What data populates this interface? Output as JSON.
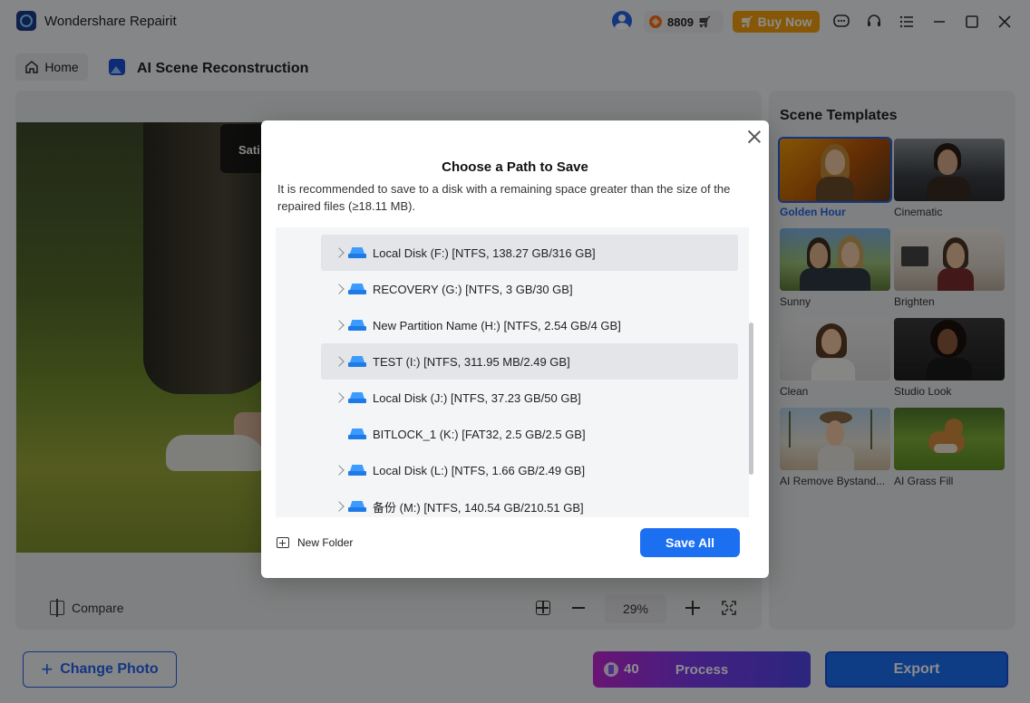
{
  "app": {
    "title": "Wondershare Repairit"
  },
  "header": {
    "credits": "8809",
    "buy_now": "Buy Now"
  },
  "nav": {
    "home": "Home",
    "page_title": "AI Scene Reconstruction"
  },
  "preview": {
    "badge_text": "Sati",
    "compare": "Compare",
    "zoom": "29%"
  },
  "templates": {
    "title": "Scene Templates",
    "items": [
      {
        "label": "Golden Hour",
        "selected": true
      },
      {
        "label": "Cinematic",
        "selected": false
      },
      {
        "label": "Sunny",
        "selected": false
      },
      {
        "label": "Brighten",
        "selected": false
      },
      {
        "label": "Clean",
        "selected": false
      },
      {
        "label": "Studio Look",
        "selected": false
      },
      {
        "label": "AI Remove Bystand...",
        "selected": false
      },
      {
        "label": "AI Grass Fill",
        "selected": false
      }
    ]
  },
  "bottom": {
    "change_photo": "Change Photo",
    "process_credits": "40",
    "process": "Process",
    "export": "Export"
  },
  "dialog": {
    "title": "Choose a Path to Save",
    "description": "It is recommended to save to a disk with a remaining space greater than the size of the repaired files (≥18.11 MB).",
    "disks": [
      {
        "label": "Local Disk (F:) [NTFS, 138.27 GB/316 GB]",
        "expandable": true,
        "highlighted": true
      },
      {
        "label": "RECOVERY (G:) [NTFS, 3 GB/30 GB]",
        "expandable": true,
        "highlighted": false
      },
      {
        "label": "New Partition Name (H:) [NTFS, 2.54 GB/4 GB]",
        "expandable": true,
        "highlighted": false
      },
      {
        "label": "TEST (I:) [NTFS, 311.95 MB/2.49 GB]",
        "expandable": true,
        "highlighted": true
      },
      {
        "label": "Local Disk (J:) [NTFS, 37.23 GB/50 GB]",
        "expandable": true,
        "highlighted": false
      },
      {
        "label": "BITLOCK_1 (K:) [FAT32, 2.5 GB/2.5 GB]",
        "expandable": false,
        "highlighted": false
      },
      {
        "label": "Local Disk (L:) [NTFS, 1.66 GB/2.49 GB]",
        "expandable": true,
        "highlighted": false
      },
      {
        "label": "备份 (M:) [NTFS, 140.54 GB/210.51 GB]",
        "expandable": true,
        "highlighted": false
      }
    ],
    "new_folder": "New Folder",
    "save_all": "Save All"
  },
  "colors": {
    "accent": "#1d6ff2",
    "buy_now": "#f59e0b",
    "overlay": "rgba(0,0,0,0.45)"
  }
}
